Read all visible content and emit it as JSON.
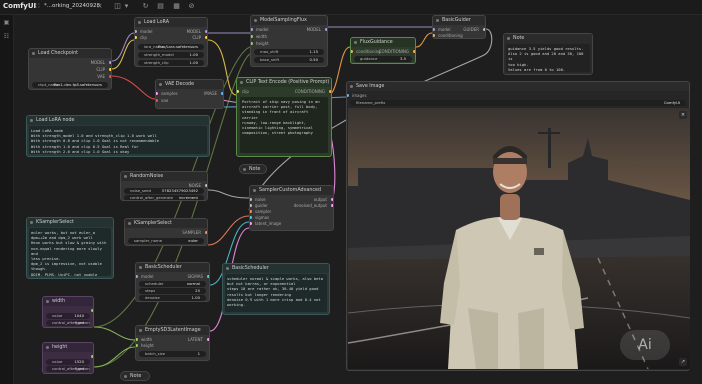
{
  "app": {
    "name": "ComfyUI",
    "workflow_title": "*...orking_20240928"
  },
  "nodes": {
    "load_lora": {
      "title": "Load LoRA",
      "in": [
        "model",
        "clip"
      ],
      "out": [
        "MODEL",
        "CLIP"
      ],
      "lora_name_label": "lora_name",
      "lora_name_value": "flux/Lora.safetensors",
      "strength_model_label": "strength_model",
      "strength_model_value": "1.00",
      "strength_clip_label": "strength_clip",
      "strength_clip_value": "1.00"
    },
    "load_checkpoint": {
      "title": "Load Checkpoint",
      "out": [
        "MODEL",
        "CLIP",
        "VAE"
      ],
      "ckpt_label": "ckpt_name",
      "ckpt_value": "flux1-dev-fp8.safetensors"
    },
    "vae_decode": {
      "title": "VAE Decode",
      "in": [
        "samples",
        "vae"
      ],
      "out": "IMAGE"
    },
    "model_sampling_flux": {
      "title": "ModelSamplingFlux",
      "in": [
        "model",
        "width",
        "height"
      ],
      "out": "MODEL",
      "max_shift_label": "max_shift",
      "max_shift_value": "1.15",
      "base_shift_label": "base_shift",
      "base_shift_value": "0.50"
    },
    "flux_guidance": {
      "title": "FluxGuidance",
      "in": "conditioning",
      "out": "CONDITIONING",
      "guidance_label": "guidance",
      "guidance_value": "3.5"
    },
    "basic_guider": {
      "title": "BasicGuider",
      "in": [
        "model",
        "conditioning"
      ],
      "out": "GUIDER"
    },
    "note_top": {
      "title": "Note",
      "text": "guidance 3.5 yields good results.\nAlso 2 is good and 20 and 30, 100 is\ntoo high.\nValues are from 0 to 100."
    },
    "clip_text": {
      "title": "CLIP Text Encode (Positive Prompt)",
      "in": "clip",
      "out": "CONDITIONING",
      "text": "Portrait of ship navy posing in an\naircraft carrier post, full body,\nstanding in front of aircraft carrier\nrunway, low-range backlight,\ncinematic lighting, symmetrical\ncomposition, street photography"
    },
    "note_mid": {
      "title": "Note"
    },
    "save_image": {
      "title": "Save Image",
      "in": "images",
      "prefix_label": "filename_prefix",
      "prefix_value": "ComfyUI"
    },
    "load_lora_note": {
      "title": "Load LoRA node",
      "text": "Load LoRA node\nWith strength_model 1.0 and strength_clip 1.0 work well\nWith strength 0.8 and clip 1.0 Goal is not recommendable\nWith strength 1.0 and clip 0.5 Goal is Real fur\nWith strength 2.0 and clip 1.0 Goal is okay"
    },
    "random_noise": {
      "title": "RandomNoise",
      "out": "NOISE",
      "seed_label": "noise_seed",
      "seed_value": "578234579023492",
      "control_label": "control_after_generate",
      "control_value": "increment"
    },
    "sampler_custom": {
      "title": "SamplerCustomAdvanced",
      "in": [
        "noise",
        "guider",
        "sampler",
        "sigmas",
        "latent_image"
      ],
      "out": [
        "output",
        "denoised_output"
      ]
    },
    "ksampler_select_note": {
      "title": "KSamplerSelect",
      "text": "euler works, but not euler_a\ndpm++2m and dpm_2 work well\nHeun works but slow & grainy with\nnon-equal rendering more slowly and\nless precise.\ndpm_2 is impressive, not usable\nthough.\nDDIM, PLMS, UniPC, not usable\ndeis, uni_pc are not usable"
    },
    "ksampler_select": {
      "title": "KSamplerSelect",
      "out": "SAMPLER",
      "sampler_label": "sampler_name",
      "sampler_value": "euler"
    },
    "basic_scheduler_note": {
      "title": "BasicScheduler",
      "text": "scheduler normal & simple works, also beta\nbut not karras, or exponential\nsteps 10 are rather ok, 30-40 yield good\nresults but longer rendering\ndenoise 0.9 with 1 more crisp and 0.4 not\nworking."
    },
    "basic_scheduler": {
      "title": "BasicScheduler",
      "in": "model",
      "out": "SIGMAS",
      "scheduler_label": "scheduler",
      "scheduler_value": "normal",
      "steps_label": "steps",
      "steps_value": "25",
      "denoise_label": "denoise",
      "denoise_value": "1.00"
    },
    "width": {
      "title": "width",
      "value_label": "value",
      "value": "1040",
      "control_label": "control_after_generate",
      "control_value": "fixed"
    },
    "height": {
      "title": "height",
      "value_label": "value",
      "value": "1520",
      "control_label": "control_after_generate",
      "control_value": "fixed"
    },
    "empty_latent": {
      "title": "EmptySD3LatentImage",
      "in": [
        "width",
        "height"
      ],
      "out": "LATENT",
      "batch_label": "batch_size",
      "batch_value": "1"
    },
    "note_bottom": {
      "title": "Note"
    }
  },
  "photo": {
    "watermark": "Ai"
  },
  "colors": {
    "model": "#b39ddb",
    "clip": "#ffd54f",
    "vae": "#ef5350",
    "conditioning": "#ffa94d",
    "latent": "#ff9cf9",
    "image": "#64b5f6",
    "int": "#9ccc65",
    "noise": "#bdbdbd",
    "sigmas": "#4dd0e1",
    "green_node": "#5a8a4a"
  }
}
